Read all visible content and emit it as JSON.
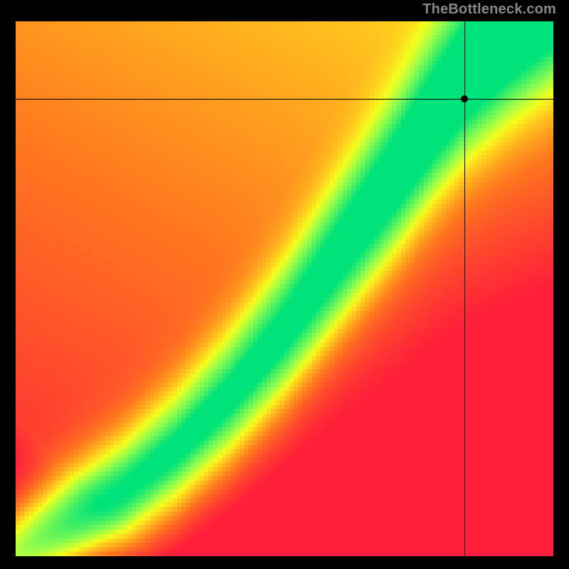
{
  "watermark": "TheBottleneck.com",
  "chart_data": {
    "type": "heatmap",
    "title": "",
    "xlabel": "",
    "ylabel": "",
    "xlim": [
      0,
      1
    ],
    "ylim": [
      0,
      1
    ],
    "grid": false,
    "legend": false,
    "description": "2D bottleneck field: value at (x,y) encodes mismatch between two component scores. Diagonal green band = balanced; red = severe bottleneck; yellow/orange = moderate.",
    "colormap_stops": [
      {
        "t": 0.0,
        "color": "#ff1f3a"
      },
      {
        "t": 0.25,
        "color": "#ff7a1e"
      },
      {
        "t": 0.45,
        "color": "#ffd21e"
      },
      {
        "t": 0.55,
        "color": "#f4ff1e"
      },
      {
        "t": 0.7,
        "color": "#9bff4a"
      },
      {
        "t": 1.0,
        "color": "#00e37a"
      }
    ],
    "ideal_curve": {
      "comment": "Approximate centerline of the green band, normalized coords (0,0)=bottom-left, (1,1)=top-right.",
      "points": [
        {
          "x": 0.0,
          "y": 0.0
        },
        {
          "x": 0.1,
          "y": 0.06
        },
        {
          "x": 0.2,
          "y": 0.12
        },
        {
          "x": 0.3,
          "y": 0.2
        },
        {
          "x": 0.4,
          "y": 0.3
        },
        {
          "x": 0.5,
          "y": 0.42
        },
        {
          "x": 0.6,
          "y": 0.56
        },
        {
          "x": 0.7,
          "y": 0.7
        },
        {
          "x": 0.78,
          "y": 0.82
        },
        {
          "x": 0.84,
          "y": 0.9
        },
        {
          "x": 0.92,
          "y": 0.98
        },
        {
          "x": 1.0,
          "y": 1.05
        }
      ]
    },
    "band_width": 0.07,
    "marker": {
      "x": 0.835,
      "y": 0.855
    },
    "pixelation": 120
  }
}
